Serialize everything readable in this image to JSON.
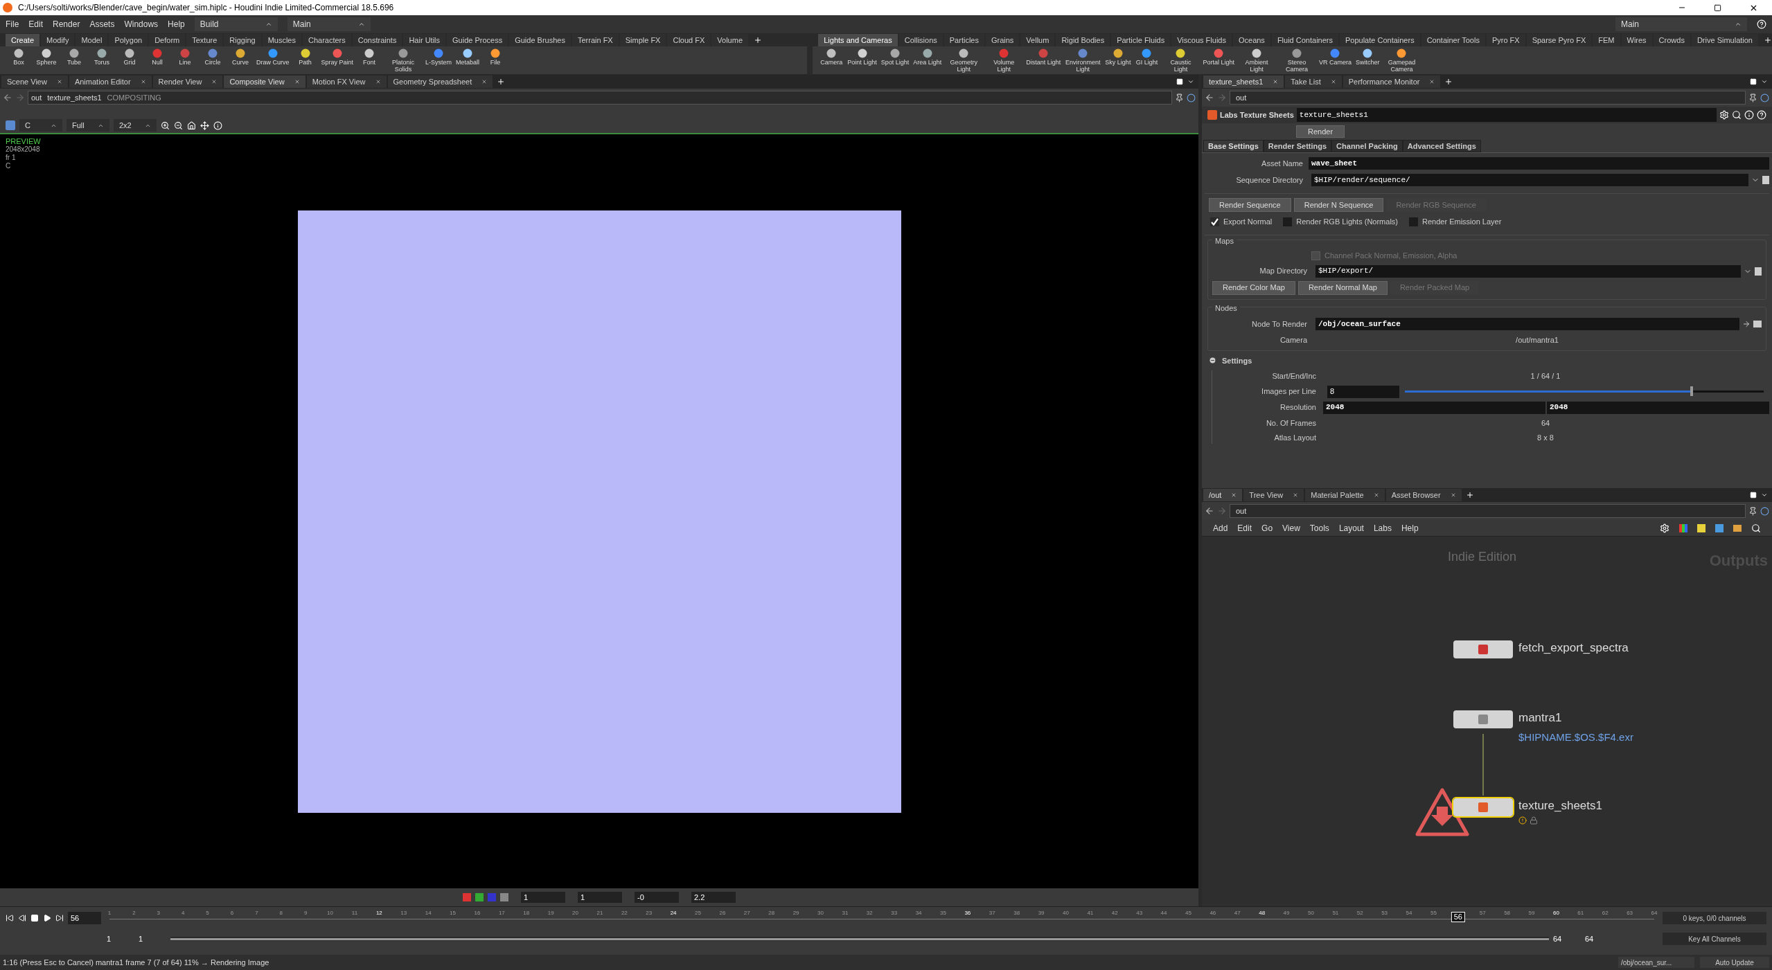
{
  "window": {
    "title": "C:/Users/solti/works/Blender/cave_begin/water_sim.hiplc - Houdini Indie Limited-Commercial 18.5.696"
  },
  "menu": [
    "File",
    "Edit",
    "Render",
    "Assets",
    "Windows",
    "Help"
  ],
  "desktop": "Build",
  "context": "Main",
  "right_context": "Main",
  "shelf_left": {
    "tabs": [
      {
        "label": "Create",
        "selected": true
      },
      {
        "label": "Modify",
        "selected": false
      },
      {
        "label": "Model",
        "selected": false
      },
      {
        "label": "Polygon",
        "selected": false
      },
      {
        "label": "Deform",
        "selected": false
      },
      {
        "label": "Texture",
        "selected": false
      },
      {
        "label": "Rigging",
        "selected": false
      },
      {
        "label": "Muscles",
        "selected": false
      },
      {
        "label": "Characters",
        "selected": false
      },
      {
        "label": "Constraints",
        "selected": false
      },
      {
        "label": "Hair Utils",
        "selected": false
      },
      {
        "label": "Guide Process",
        "selected": false
      },
      {
        "label": "Guide Brushes",
        "selected": false
      },
      {
        "label": "Terrain FX",
        "selected": false
      },
      {
        "label": "Simple FX",
        "selected": false
      },
      {
        "label": "Cloud FX",
        "selected": false
      },
      {
        "label": "Volume",
        "selected": false
      }
    ],
    "tools": [
      "Box",
      "Sphere",
      "Tube",
      "Torus",
      "Grid",
      "Null",
      "Line",
      "Circle",
      "Curve",
      "Draw Curve",
      "Path",
      "Spray Paint",
      "Font",
      "Platonic Solids",
      "L-System",
      "Metaball",
      "File"
    ]
  },
  "shelf_right": {
    "tabs": [
      {
        "label": "Lights and Cameras",
        "selected": true
      },
      {
        "label": "Collisions",
        "selected": false
      },
      {
        "label": "Particles",
        "selected": false
      },
      {
        "label": "Grains",
        "selected": false
      },
      {
        "label": "Vellum",
        "selected": false
      },
      {
        "label": "Rigid Bodies",
        "selected": false
      },
      {
        "label": "Particle Fluids",
        "selected": false
      },
      {
        "label": "Viscous Fluids",
        "selected": false
      },
      {
        "label": "Oceans",
        "selected": false
      },
      {
        "label": "Fluid Containers",
        "selected": false
      },
      {
        "label": "Populate Containers",
        "selected": false
      },
      {
        "label": "Container Tools",
        "selected": false
      },
      {
        "label": "Pyro FX",
        "selected": false
      },
      {
        "label": "Sparse Pyro FX",
        "selected": false
      },
      {
        "label": "FEM",
        "selected": false
      },
      {
        "label": "Wires",
        "selected": false
      },
      {
        "label": "Crowds",
        "selected": false
      },
      {
        "label": "Drive Simulation",
        "selected": false
      }
    ],
    "tools": [
      "Camera",
      "Point Light",
      "Spot Light",
      "Area Light",
      "Geometry Light",
      "Volume Light",
      "Distant Light",
      "Environment Light",
      "Sky Light",
      "GI Light",
      "Caustic Light",
      "Portal Light",
      "Ambient Light",
      "Stereo Camera",
      "VR Camera",
      "Switcher",
      "Gamepad Camera"
    ]
  },
  "left_pane": {
    "tabs": [
      {
        "label": "Scene View",
        "selected": false
      },
      {
        "label": "Animation Editor",
        "selected": false
      },
      {
        "label": "Render View",
        "selected": false
      },
      {
        "label": "Composite View",
        "selected": true
      },
      {
        "label": "Motion FX View",
        "selected": false
      },
      {
        "label": "Geometry Spreadsheet",
        "selected": false
      }
    ],
    "path": [
      "out",
      "texture_sheets1",
      "COMPOSITING"
    ],
    "toolbar_fields": [
      "C",
      "Full",
      "2x2"
    ],
    "overlay": [
      "PREVIEW",
      "2048x2048",
      "fr 1",
      "C"
    ],
    "bottom_fields": [
      "1",
      "1",
      "-0",
      "2.2"
    ]
  },
  "params": {
    "tabs": [
      {
        "label": "texture_sheets1",
        "selected": true
      },
      {
        "label": "Take List",
        "selected": false
      },
      {
        "label": "Performance Monitor",
        "selected": false
      }
    ],
    "path": "out",
    "node_type": "Labs Texture Sheets",
    "node_name": "texture_sheets1",
    "render_button": "Render",
    "param_tabs": [
      {
        "label": "Base Settings",
        "selected": true
      },
      {
        "label": "Render Settings",
        "selected": false
      },
      {
        "label": "Channel Packing",
        "selected": false
      },
      {
        "label": "Advanced Settings",
        "selected": false
      }
    ],
    "asset_name": {
      "label": "Asset Name",
      "value": "wave_sheet"
    },
    "sequence_dir": {
      "label": "Sequence Directory",
      "value": "$HIP/render/sequence/"
    },
    "seq_buttons": [
      {
        "label": "Render Sequence",
        "disabled": false
      },
      {
        "label": "Render N Sequence",
        "disabled": false
      },
      {
        "label": "Render RGB Sequence",
        "disabled": true
      }
    ],
    "checks": [
      {
        "label": "Export Normal",
        "checked": true
      },
      {
        "label": "Render RGB Lights (Normals)",
        "checked": false
      },
      {
        "label": "Render Emission Layer",
        "checked": false
      }
    ],
    "maps": {
      "title": "Maps",
      "channel_pack": {
        "label": "Channel Pack Normal, Emission, Alpha",
        "checked": false,
        "disabled": true
      },
      "dir_label": "Map Directory",
      "dir": "$HIP/export/",
      "buttons": [
        {
          "label": "Render Color Map",
          "disabled": false
        },
        {
          "label": "Render Normal Map",
          "disabled": false
        },
        {
          "label": "Render Packed Map",
          "disabled": true
        }
      ]
    },
    "nodes": {
      "title": "Nodes",
      "node_label": "Node To Render",
      "node": "/obj/ocean_surface",
      "camera_label": "Camera",
      "camera": "/out/mantra1"
    },
    "settings": {
      "title": "Settings",
      "expanded": true,
      "sei_label": "Start/End/Inc",
      "sei": [
        "1",
        "/",
        "64",
        "/",
        "1"
      ],
      "ipl_label": "Images per Line",
      "ipl": "8",
      "level": 0.8,
      "res_label": "Resolution",
      "res": [
        "2048",
        "2048"
      ],
      "frames_label": "No. Of Frames",
      "frames": "64",
      "atlas_label": "Atlas Layout",
      "atlas": "8 x 8"
    }
  },
  "network": {
    "tabs": [
      {
        "label": "/out",
        "selected": true
      },
      {
        "label": "Tree View",
        "selected": false
      },
      {
        "label": "Material Palette",
        "selected": false
      },
      {
        "label": "Asset Browser",
        "selected": false
      }
    ],
    "path": "out",
    "menu": [
      "Add",
      "Edit",
      "Go",
      "View",
      "Tools",
      "Layout",
      "Labs",
      "Help"
    ],
    "watermark_edition": "Indie Edition",
    "context_label": "Outputs",
    "nodes": [
      {
        "name": "fetch_export_spectra",
        "selected": false
      },
      {
        "name": "mantra1",
        "selected": false,
        "detail": "$HIPNAME.$OS.$F4.exr"
      },
      {
        "name": "texture_sheets1",
        "selected": true,
        "warning": true
      }
    ]
  },
  "timeline": {
    "frame": "56",
    "ticks": [
      {
        "label": "1",
        "current": false
      },
      {
        "label": "2",
        "current": false
      },
      {
        "label": "3",
        "current": false
      },
      {
        "label": "4",
        "current": false
      },
      {
        "label": "5",
        "current": false
      },
      {
        "label": "6",
        "current": false
      },
      {
        "label": "7",
        "current": false
      },
      {
        "label": "8",
        "current": false
      },
      {
        "label": "9",
        "current": false
      },
      {
        "label": "10",
        "current": false
      },
      {
        "label": "11",
        "current": false
      },
      {
        "label": "12",
        "current": false
      },
      {
        "label": "13",
        "current": false
      },
      {
        "label": "14",
        "current": false
      },
      {
        "label": "15",
        "current": false
      },
      {
        "label": "16",
        "current": false
      },
      {
        "label": "17",
        "current": false
      },
      {
        "label": "18",
        "current": false
      },
      {
        "label": "19",
        "current": false
      },
      {
        "label": "20",
        "current": false
      },
      {
        "label": "21",
        "current": false
      },
      {
        "label": "22",
        "current": false
      },
      {
        "label": "23",
        "current": false
      },
      {
        "label": "24",
        "current": false
      },
      {
        "label": "25",
        "current": false
      },
      {
        "label": "26",
        "current": false
      },
      {
        "label": "27",
        "current": false
      },
      {
        "label": "28",
        "current": false
      },
      {
        "label": "29",
        "current": false
      },
      {
        "label": "30",
        "current": false
      },
      {
        "label": "31",
        "current": false
      },
      {
        "label": "32",
        "current": false
      },
      {
        "label": "33",
        "current": false
      },
      {
        "label": "34",
        "current": false
      },
      {
        "label": "35",
        "current": false
      },
      {
        "label": "36",
        "current": false
      },
      {
        "label": "37",
        "current": false
      },
      {
        "label": "38",
        "current": false
      },
      {
        "label": "39",
        "current": false
      },
      {
        "label": "40",
        "current": false
      },
      {
        "label": "41",
        "current": false
      },
      {
        "label": "42",
        "current": false
      },
      {
        "label": "43",
        "current": false
      },
      {
        "label": "44",
        "current": false
      },
      {
        "label": "45",
        "current": false
      },
      {
        "label": "46",
        "current": false
      },
      {
        "label": "47",
        "current": false
      },
      {
        "label": "48",
        "current": false
      },
      {
        "label": "49",
        "current": false
      },
      {
        "label": "50",
        "current": false
      },
      {
        "label": "51",
        "current": false
      },
      {
        "label": "52",
        "current": false
      },
      {
        "label": "53",
        "current": false
      },
      {
        "label": "54",
        "current": false
      },
      {
        "label": "55",
        "current": false
      },
      {
        "label": "56",
        "current": true
      },
      {
        "label": "57",
        "current": false
      },
      {
        "label": "58",
        "current": false
      },
      {
        "label": "59",
        "current": false
      },
      {
        "label": "60",
        "current": false
      },
      {
        "label": "61",
        "current": false
      },
      {
        "label": "62",
        "current": false
      },
      {
        "label": "63",
        "current": false
      },
      {
        "label": "64",
        "current": false
      }
    ],
    "level": 1,
    "range": [
      "1",
      "1",
      "64",
      "64"
    ],
    "keys": "0 keys, 0/0 channels",
    "key_all": "Key All Channels"
  },
  "status": {
    "message": "1:16 (Press Esc to Cancel) mantra1 frame 7 (7 of 64) 11% → Rendering Image",
    "path": "/obj/ocean_sur...",
    "update": "Auto Update"
  }
}
